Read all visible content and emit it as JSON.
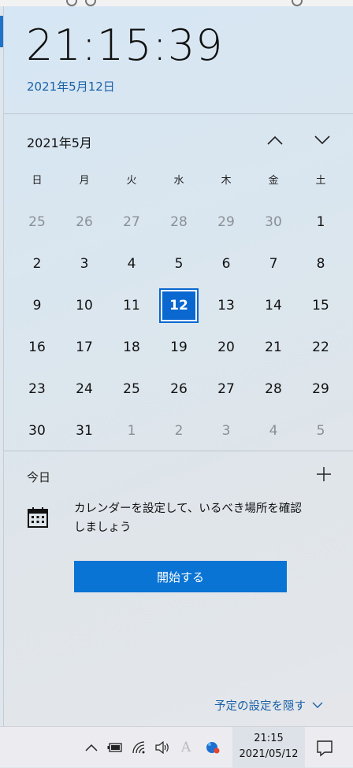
{
  "clock": {
    "time": "21:15:39",
    "date_long": "2021年5月12日"
  },
  "calendar": {
    "month_label": "2021年5月",
    "weekdays": [
      "日",
      "月",
      "火",
      "水",
      "木",
      "金",
      "土"
    ],
    "weeks": [
      [
        {
          "d": "25",
          "o": true
        },
        {
          "d": "26",
          "o": true
        },
        {
          "d": "27",
          "o": true
        },
        {
          "d": "28",
          "o": true
        },
        {
          "d": "29",
          "o": true
        },
        {
          "d": "30",
          "o": true
        },
        {
          "d": "1",
          "o": false
        }
      ],
      [
        {
          "d": "2",
          "o": false
        },
        {
          "d": "3",
          "o": false
        },
        {
          "d": "4",
          "o": false
        },
        {
          "d": "5",
          "o": false
        },
        {
          "d": "6",
          "o": false
        },
        {
          "d": "7",
          "o": false
        },
        {
          "d": "8",
          "o": false
        }
      ],
      [
        {
          "d": "9",
          "o": false
        },
        {
          "d": "10",
          "o": false
        },
        {
          "d": "11",
          "o": false
        },
        {
          "d": "12",
          "o": false,
          "today": true
        },
        {
          "d": "13",
          "o": false
        },
        {
          "d": "14",
          "o": false
        },
        {
          "d": "15",
          "o": false
        }
      ],
      [
        {
          "d": "16",
          "o": false
        },
        {
          "d": "17",
          "o": false
        },
        {
          "d": "18",
          "o": false
        },
        {
          "d": "19",
          "o": false
        },
        {
          "d": "20",
          "o": false
        },
        {
          "d": "21",
          "o": false
        },
        {
          "d": "22",
          "o": false
        }
      ],
      [
        {
          "d": "23",
          "o": false
        },
        {
          "d": "24",
          "o": false
        },
        {
          "d": "25",
          "o": false
        },
        {
          "d": "26",
          "o": false
        },
        {
          "d": "27",
          "o": false
        },
        {
          "d": "28",
          "o": false
        },
        {
          "d": "29",
          "o": false
        }
      ],
      [
        {
          "d": "30",
          "o": false
        },
        {
          "d": "31",
          "o": false
        },
        {
          "d": "1",
          "o": true
        },
        {
          "d": "2",
          "o": true
        },
        {
          "d": "3",
          "o": true
        },
        {
          "d": "4",
          "o": true
        },
        {
          "d": "5",
          "o": true
        }
      ]
    ],
    "accent_color": "#0a68d0"
  },
  "agenda": {
    "today_label": "今日",
    "message": "カレンダーを設定して、いるべき場所を確認しましょう",
    "start_button": "開始する",
    "hide_link": "予定の設定を隠す"
  },
  "taskbar": {
    "time": "21:15",
    "date": "2021/05/12",
    "ime_glyph": "A",
    "icons": [
      "chevron-up-icon",
      "battery-icon",
      "wifi-icon",
      "volume-icon",
      "ime-icon",
      "app-icon",
      "notification-icon"
    ]
  }
}
